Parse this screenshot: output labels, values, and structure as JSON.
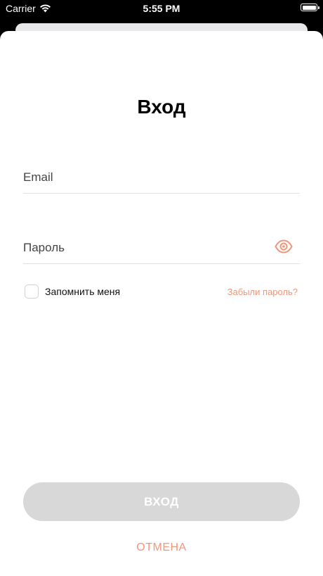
{
  "status_bar": {
    "carrier": "Carrier",
    "time": "5:55 PM",
    "icons": [
      "wifi-icon",
      "battery-icon"
    ]
  },
  "login": {
    "title": "Вход",
    "email_placeholder": "Email",
    "password_placeholder": "Пароль",
    "remember_label": "Запомнить меня",
    "remember_checked": false,
    "forgot_label": "Забыли пароль?",
    "submit_label": "ВХОД",
    "cancel_label": "ОТМЕНА"
  },
  "colors": {
    "accent": "#f0967a",
    "button_disabled": "#d8d8d8",
    "divider": "#e2e2e2"
  }
}
